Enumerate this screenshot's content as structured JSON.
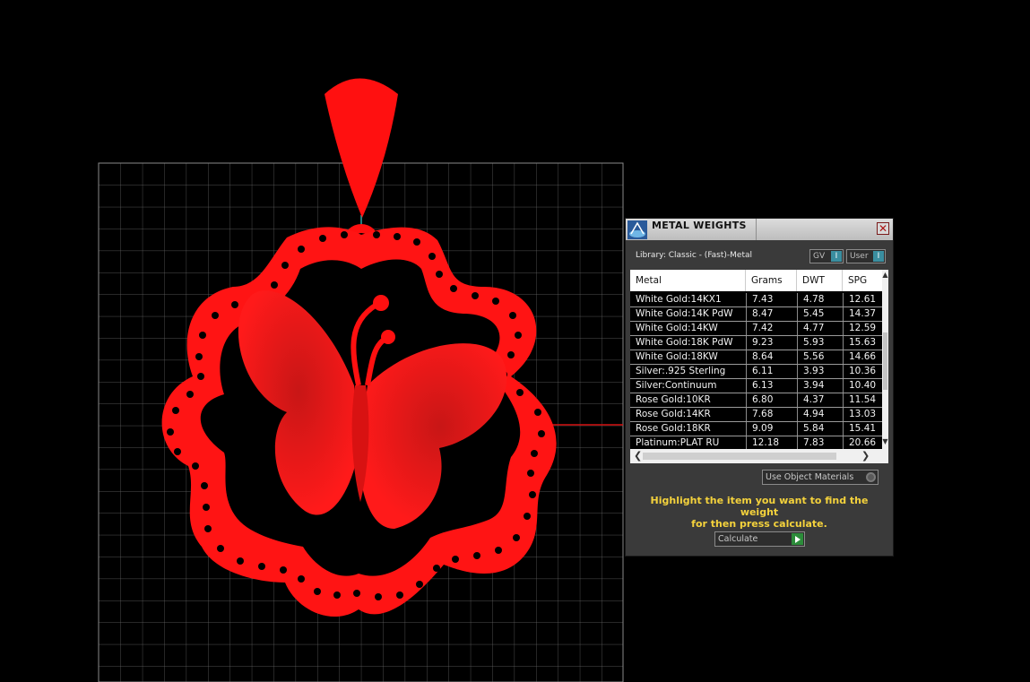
{
  "panel": {
    "title": "METAL WEIGHTS",
    "library_label": "Library: Classic - (Fast)-Metal",
    "gv_toggle": {
      "label": "GV",
      "indicator": "I"
    },
    "user_toggle": {
      "label": "User",
      "indicator": "I"
    },
    "table": {
      "headers": [
        "Metal",
        "Grams",
        "DWT",
        "SPG"
      ],
      "rows": [
        [
          "White Gold:14KX1",
          "7.43",
          "4.78",
          "12.61"
        ],
        [
          "White Gold:14K PdW",
          "8.47",
          "5.45",
          "14.37"
        ],
        [
          "White Gold:14KW",
          "7.42",
          "4.77",
          "12.59"
        ],
        [
          "White Gold:18K PdW",
          "9.23",
          "5.93",
          "15.63"
        ],
        [
          "White Gold:18KW",
          "8.64",
          "5.56",
          "14.66"
        ],
        [
          "Silver:.925 Sterling",
          "6.11",
          "3.93",
          "10.36"
        ],
        [
          "Silver:Continuum",
          "6.13",
          "3.94",
          "10.40"
        ],
        [
          "Rose Gold:10KR",
          "6.80",
          "4.37",
          "11.54"
        ],
        [
          "Rose Gold:14KR",
          "7.68",
          "4.94",
          "13.03"
        ],
        [
          "Rose Gold:18KR",
          "9.09",
          "5.84",
          "15.41"
        ],
        [
          "Platinum:PLAT RU",
          "12.18",
          "7.83",
          "20.66"
        ]
      ]
    },
    "use_object_materials_label": "Use Object Materials",
    "hint_line1": "Highlight the item you want to find the weight",
    "hint_line2": "for then press calculate.",
    "calculate_label": "Calculate",
    "close_symbol": "✕"
  },
  "colors": {
    "model": "#ff0000",
    "grid": "#5a5a5a",
    "hint": "#f4d23c",
    "panel_bg": "#3a3a3a"
  },
  "icons": [
    "app-logo-icon",
    "close-icon",
    "chevron-up-icon",
    "chevron-down-icon",
    "chevron-left-icon",
    "chevron-right-icon",
    "play-icon"
  ]
}
